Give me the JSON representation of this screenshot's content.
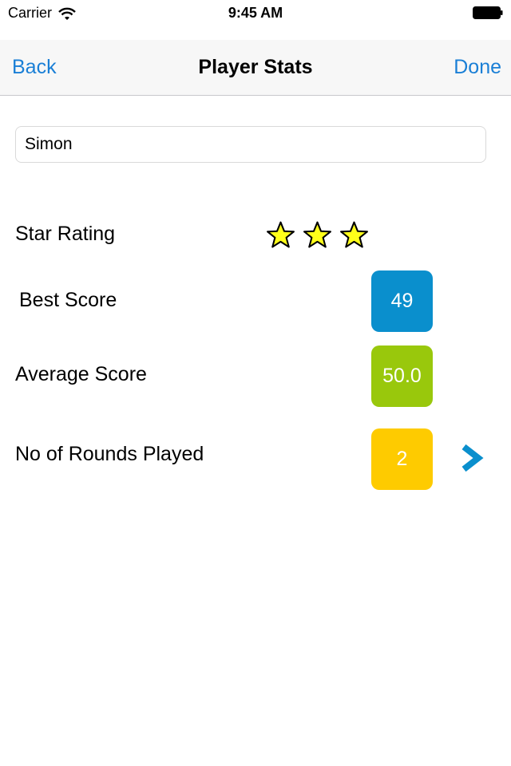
{
  "status_bar": {
    "carrier": "Carrier",
    "time": "9:45 AM",
    "icons": [
      "wifi-icon",
      "battery-icon"
    ]
  },
  "nav": {
    "back_label": "Back",
    "title": "Player Stats",
    "done_label": "Done",
    "accent_color": "#1a7fd6"
  },
  "player": {
    "name": "Simon"
  },
  "stats": {
    "star_rating_label": "Star Rating",
    "star_rating_value": 3,
    "best_score_label": "Best Score",
    "best_score": "49",
    "best_score_color": "#0a8fcd",
    "average_score_label": "Average Score",
    "average_score": "50.0",
    "average_score_color": "#99c80c",
    "rounds_label": "No of Rounds Played",
    "rounds": "2",
    "rounds_color": "#fecb00",
    "chevron_icon": "chevron-right-icon"
  }
}
